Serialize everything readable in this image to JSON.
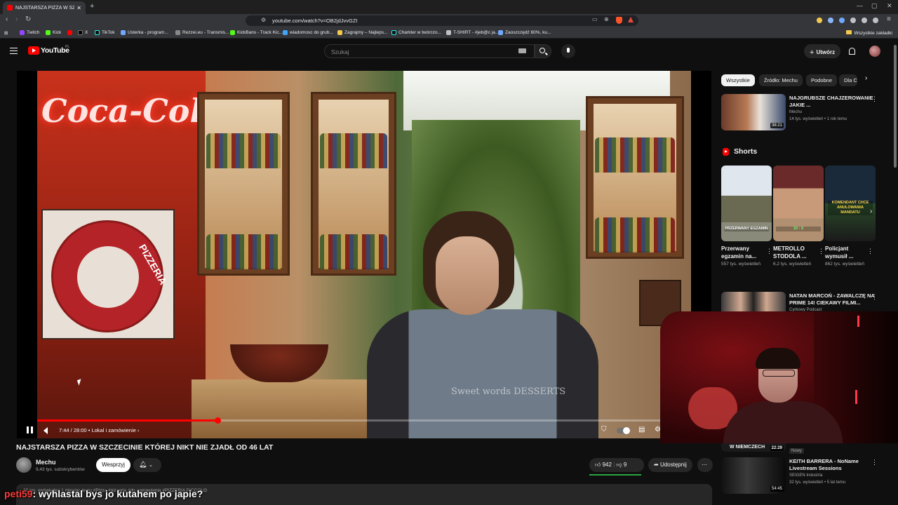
{
  "browser": {
    "tab_title": "NAJSTARSZA PIZZA W SZCZE",
    "url": "youtube.com/watch?v=OB2jdJvvGZI",
    "bookmarks": [
      "Twitch",
      "Kick",
      "X",
      "TikTok",
      "Usterka - program...",
      "Rezzei.eu - Transmis...",
      "KickBans - Track Kic...",
      "wiadomosc do grub...",
      "Zagrajmy – Najleps...",
      "Charkter w twórczo...",
      "T-SHIRT - #jeb@c ja...",
      "Zaoszczędź 60%, ku..."
    ],
    "bookmarks_all": "Wszystkie zakładki"
  },
  "yt_header": {
    "logo": "YouTube",
    "region": "PL",
    "search_placeholder": "Szukaj",
    "create_label": "Utwórz"
  },
  "player": {
    "time": "7:44 / 28:00",
    "chapter": "Lokal i zamówienie",
    "progress_fraction": 0.276,
    "accent": "#ff0000",
    "overlay_texts": {
      "coca_cola": "Coca-Cola",
      "pizzeria": "PIZZERIA",
      "shirt": "Sweet words DESSERTS"
    }
  },
  "video": {
    "title": "NAJSTARSZA PIZZA W SZCZECINIE KTÓREJ NIKT NIE ZJADŁ OD 46 LAT",
    "channel": "Mechu",
    "subscribers": "9,43 tys. subskrybentów",
    "join_label": "Wesprzyj",
    "likes": "942",
    "dislikes": "9",
    "share_label": "Udostępnij",
    "description_preview": "30 tys. wyświetleń  1 miesiąc temu  #Pizza #pizzeria #do poprawienia #PIZZERIA PICCOLO"
  },
  "chat_overlay": {
    "user": "peti59",
    "message": ": wyhlastal bys jo kutahem po japie?"
  },
  "sidebar": {
    "chips": [
      "Wszystkie",
      "Źródło: Mechu",
      "Podobne",
      "Dla C"
    ],
    "rec_top": {
      "title": "NAJGRUBSZE CHAJZEROWANIE JAKIE ...",
      "channel": "Mechu",
      "meta": "14 tys. wyświetleń • 1 rok temu",
      "duration": "38:21"
    },
    "shorts_heading": "Shorts",
    "shorts": [
      {
        "title": "Przerwany egzamin na...",
        "views": "557 tys. wyświetleń",
        "caption": "PRZERWANY EGZAMIN"
      },
      {
        "title": "METROLLO STODOLA ...",
        "views": "6,2 tys. wyświetleń",
        "caption": "10 : 5"
      },
      {
        "title": "Policjant wymusił ...",
        "views": "862 tys. wyświetleń",
        "caption": "KOMENDANT CHCE ANULOWANIA MANDATU"
      }
    ],
    "rec_mid": {
      "title": "NATAN MARCOŃ - ZAWALCZĘ NA PRIME 14! CIEKAWY FILMI...",
      "channel": "Cyrkowy Podcast"
    },
    "rec_bottom_strip": "W NIEMCZECH",
    "rec_bottom_duration_top": "22:29",
    "rec_bottom": {
      "badge": "Nowy",
      "title": "KEITH BARRERA - NoName Livestream Sessions",
      "channel": "SEIGEN Industria",
      "meta": "32 tys. wyświetleń • 5 lat temu",
      "duration": "54:45"
    }
  }
}
